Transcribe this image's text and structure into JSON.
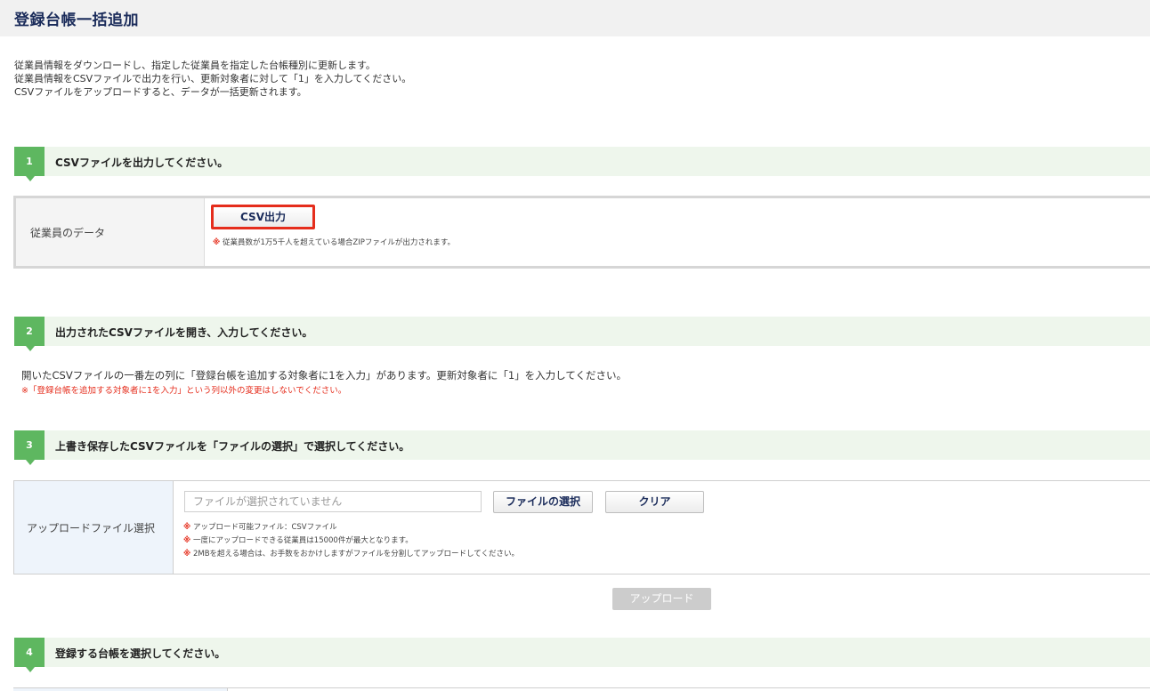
{
  "header": {
    "title": "登録台帳一括追加"
  },
  "intro": {
    "lines": [
      "従業員情報をダウンロードし、指定した従業員を指定した台帳種別に更新します。",
      "従業員情報をCSVファイルで出力を行い、更新対象者に対して「1」を入力してください。",
      "CSVファイルをアップロードすると、データが一括更新されます。"
    ]
  },
  "step1": {
    "number": "1",
    "title": "CSVファイルを出力してください。",
    "row_label": "従業員のデータ",
    "button_label": "CSV出力",
    "note_mark": "※",
    "note": "従業員数が1万5千人を超えている場合ZIPファイルが出力されます。"
  },
  "step2": {
    "number": "2",
    "title": "出力されたCSVファイルを開き、入力してください。",
    "text": "開いたCSVファイルの一番左の列に「登録台帳を追加する対象者に1を入力」があります。更新対象者に「1」を入力してください。",
    "warning": "※「登録台帳を追加する対象者に1を入力」という列以外の変更はしないでください。"
  },
  "step3": {
    "number": "3",
    "title": "上書き保存したCSVファイルを「ファイルの選択」で選択してください。",
    "row_label": "アップロードファイル選択",
    "file_placeholder": "ファイルが選択されていません",
    "select_button": "ファイルの選択",
    "clear_button": "クリア",
    "note_mark": "※",
    "notes": [
      "アップロード可能ファイル：CSVファイル",
      "一度にアップロードできる従業員は15000件が最大となります。",
      "2MBを超える場合は、お手数をおかけしますがファイルを分割してアップロードしてください。"
    ],
    "upload_button": "アップロード"
  },
  "step4": {
    "number": "4",
    "title": "登録する台帳を選択してください。"
  },
  "colors": {
    "step_accent": "#5eb760",
    "step_bar_bg": "#eef6ec",
    "title_text": "#1a2b5a",
    "warning": "#e52d1c",
    "highlight_border": "#e52d1c",
    "disabled_button": "#cccccc"
  }
}
